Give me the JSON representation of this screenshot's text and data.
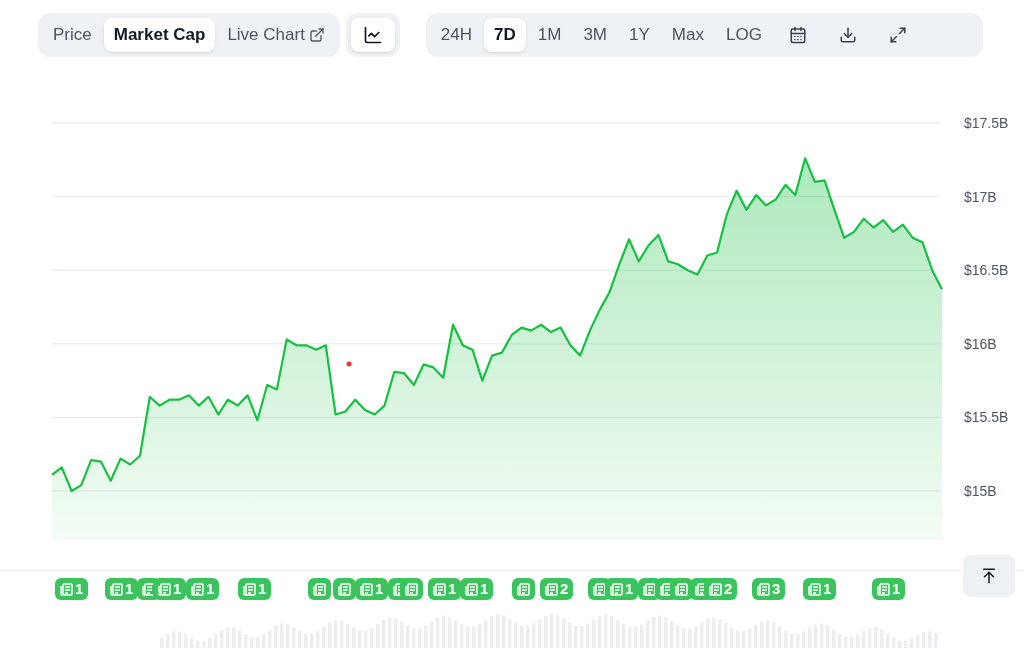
{
  "view_tabs": [
    {
      "label": "Price",
      "selected": false
    },
    {
      "label": "Market Cap",
      "selected": true
    },
    {
      "label": "Live Chart",
      "selected": false,
      "external": true
    }
  ],
  "chart_type_button": {
    "selected": true
  },
  "ranges": [
    {
      "label": "24H",
      "selected": false
    },
    {
      "label": "7D",
      "selected": true
    },
    {
      "label": "1M",
      "selected": false
    },
    {
      "label": "3M",
      "selected": false
    },
    {
      "label": "1Y",
      "selected": false
    },
    {
      "label": "Max",
      "selected": false
    },
    {
      "label": "LOG",
      "selected": false
    }
  ],
  "chart": {
    "chart_data": {
      "type": "area",
      "grid": true,
      "ylim": [
        15,
        17.5
      ],
      "yticks": [
        {
          "value": 15,
          "label": "$15B"
        },
        {
          "value": 15.5,
          "label": "$15.5B"
        },
        {
          "value": 16,
          "label": "$16B"
        },
        {
          "value": 16.5,
          "label": "$16.5B"
        },
        {
          "value": 17,
          "label": "$17B"
        },
        {
          "value": 17.5,
          "label": "$17.5B"
        }
      ],
      "series": [
        {
          "color": "#16c141",
          "values": [
            15.11,
            15.16,
            15,
            15.04,
            15.21,
            15.2,
            15.07,
            15.22,
            15.18,
            15.24,
            15.64,
            15.58,
            15.62,
            15.62,
            15.65,
            15.58,
            15.64,
            15.52,
            15.62,
            15.58,
            15.65,
            15.48,
            15.72,
            15.69,
            16.03,
            15.99,
            15.99,
            15.96,
            15.99,
            15.52,
            15.54,
            15.62,
            15.55,
            15.52,
            15.58,
            15.81,
            15.8,
            15.72,
            15.86,
            15.84,
            15.77,
            16.13,
            15.99,
            15.96,
            15.75,
            15.92,
            15.94,
            16.06,
            16.11,
            16.09,
            16.13,
            16.08,
            16.11,
            15.99,
            15.92,
            16.09,
            16.23,
            16.35,
            16.54,
            16.71,
            16.56,
            16.67,
            16.74,
            16.56,
            16.54,
            16.5,
            16.47,
            16.6,
            16.62,
            16.88,
            17.04,
            16.91,
            17.01,
            16.94,
            16.98,
            17.08,
            17.01,
            17.26,
            17.1,
            17.11,
            16.91,
            16.72,
            16.76,
            16.85,
            16.79,
            16.84,
            16.76,
            16.81,
            16.72,
            16.69,
            16.5,
            16.37
          ]
        }
      ]
    }
  },
  "news_markers": [
    {
      "kind": "count",
      "count": "1"
    },
    {
      "kind": "count",
      "count": "1"
    },
    {
      "kind": "covered"
    },
    {
      "kind": "count",
      "count": "1"
    },
    {
      "kind": "count",
      "count": "1"
    },
    {
      "kind": "count",
      "count": "1"
    },
    {
      "kind": "covered"
    },
    {
      "kind": "covered"
    },
    {
      "kind": "count",
      "count": "1"
    },
    {
      "kind": "covered"
    },
    {
      "kind": "covered"
    },
    {
      "kind": "count",
      "count": "1"
    },
    {
      "kind": "count",
      "count": "1"
    },
    {
      "kind": "covered"
    },
    {
      "kind": "count",
      "count": "2"
    },
    {
      "kind": "covered"
    },
    {
      "kind": "count",
      "count": "1"
    },
    {
      "kind": "covered"
    },
    {
      "kind": "covered"
    },
    {
      "kind": "covered"
    },
    {
      "kind": "covered"
    },
    {
      "kind": "count",
      "count": "2"
    },
    {
      "kind": "count",
      "count": "3"
    },
    {
      "kind": "count",
      "count": "1"
    },
    {
      "kind": "count",
      "count": "1"
    }
  ]
}
